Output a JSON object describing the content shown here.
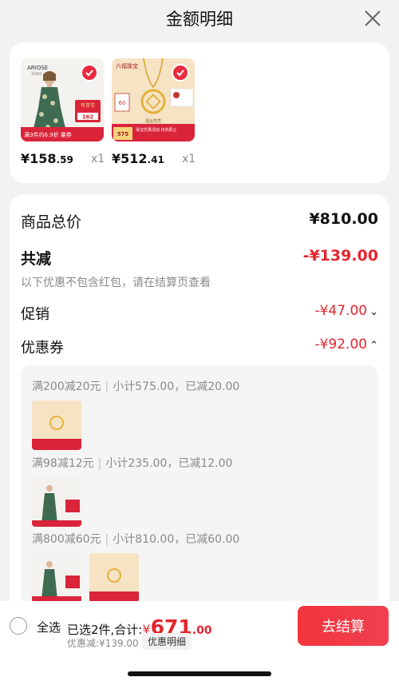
{
  "header": {
    "title": "金额明细"
  },
  "products": [
    {
      "brand": "ARIOSE",
      "brand_sub": "TEARS",
      "badge": "年货节",
      "badge_price": "162",
      "promo": "满3件约6.9折 量券",
      "price_int": "¥158",
      "price_dec": ".59",
      "qty": "x1"
    },
    {
      "brand": "六福珠宝",
      "cert": "60",
      "tag": "福运亮亮",
      "promo": "珠宝优惠活动 抢完即止",
      "promo_price": "575",
      "price_int": "¥512",
      "price_dec": ".41",
      "qty": "x1"
    }
  ],
  "summary": {
    "total_label": "商品总价",
    "total_value": "¥810.00",
    "reduce_label": "共减",
    "reduce_value": "-¥139.00",
    "note": "以下优惠不包含红包，请在结算页查看",
    "promo_label": "促销",
    "promo_value": "-¥47.00",
    "coupon_label": "优惠券",
    "coupon_value": "-¥92.00"
  },
  "coupons": [
    {
      "rule": "满200减20元",
      "detail": "小计575.00，已减20.00"
    },
    {
      "rule": "满98减12元",
      "detail": "小计235.00，已减12.00"
    },
    {
      "rule": "满800减60元",
      "detail": "小计810.00，已减60.00"
    }
  ],
  "bottom": {
    "select_all": "全选",
    "selected_text": "已选2件,合计:",
    "total_cur": "¥",
    "total_int": "671",
    "total_dec": ".00",
    "discount_text": "优惠减:¥139.00",
    "detail_chip": "优惠明细",
    "checkout": "去结算"
  },
  "colors": {
    "accent": "#e4262f",
    "checkout": "#f2353c"
  }
}
